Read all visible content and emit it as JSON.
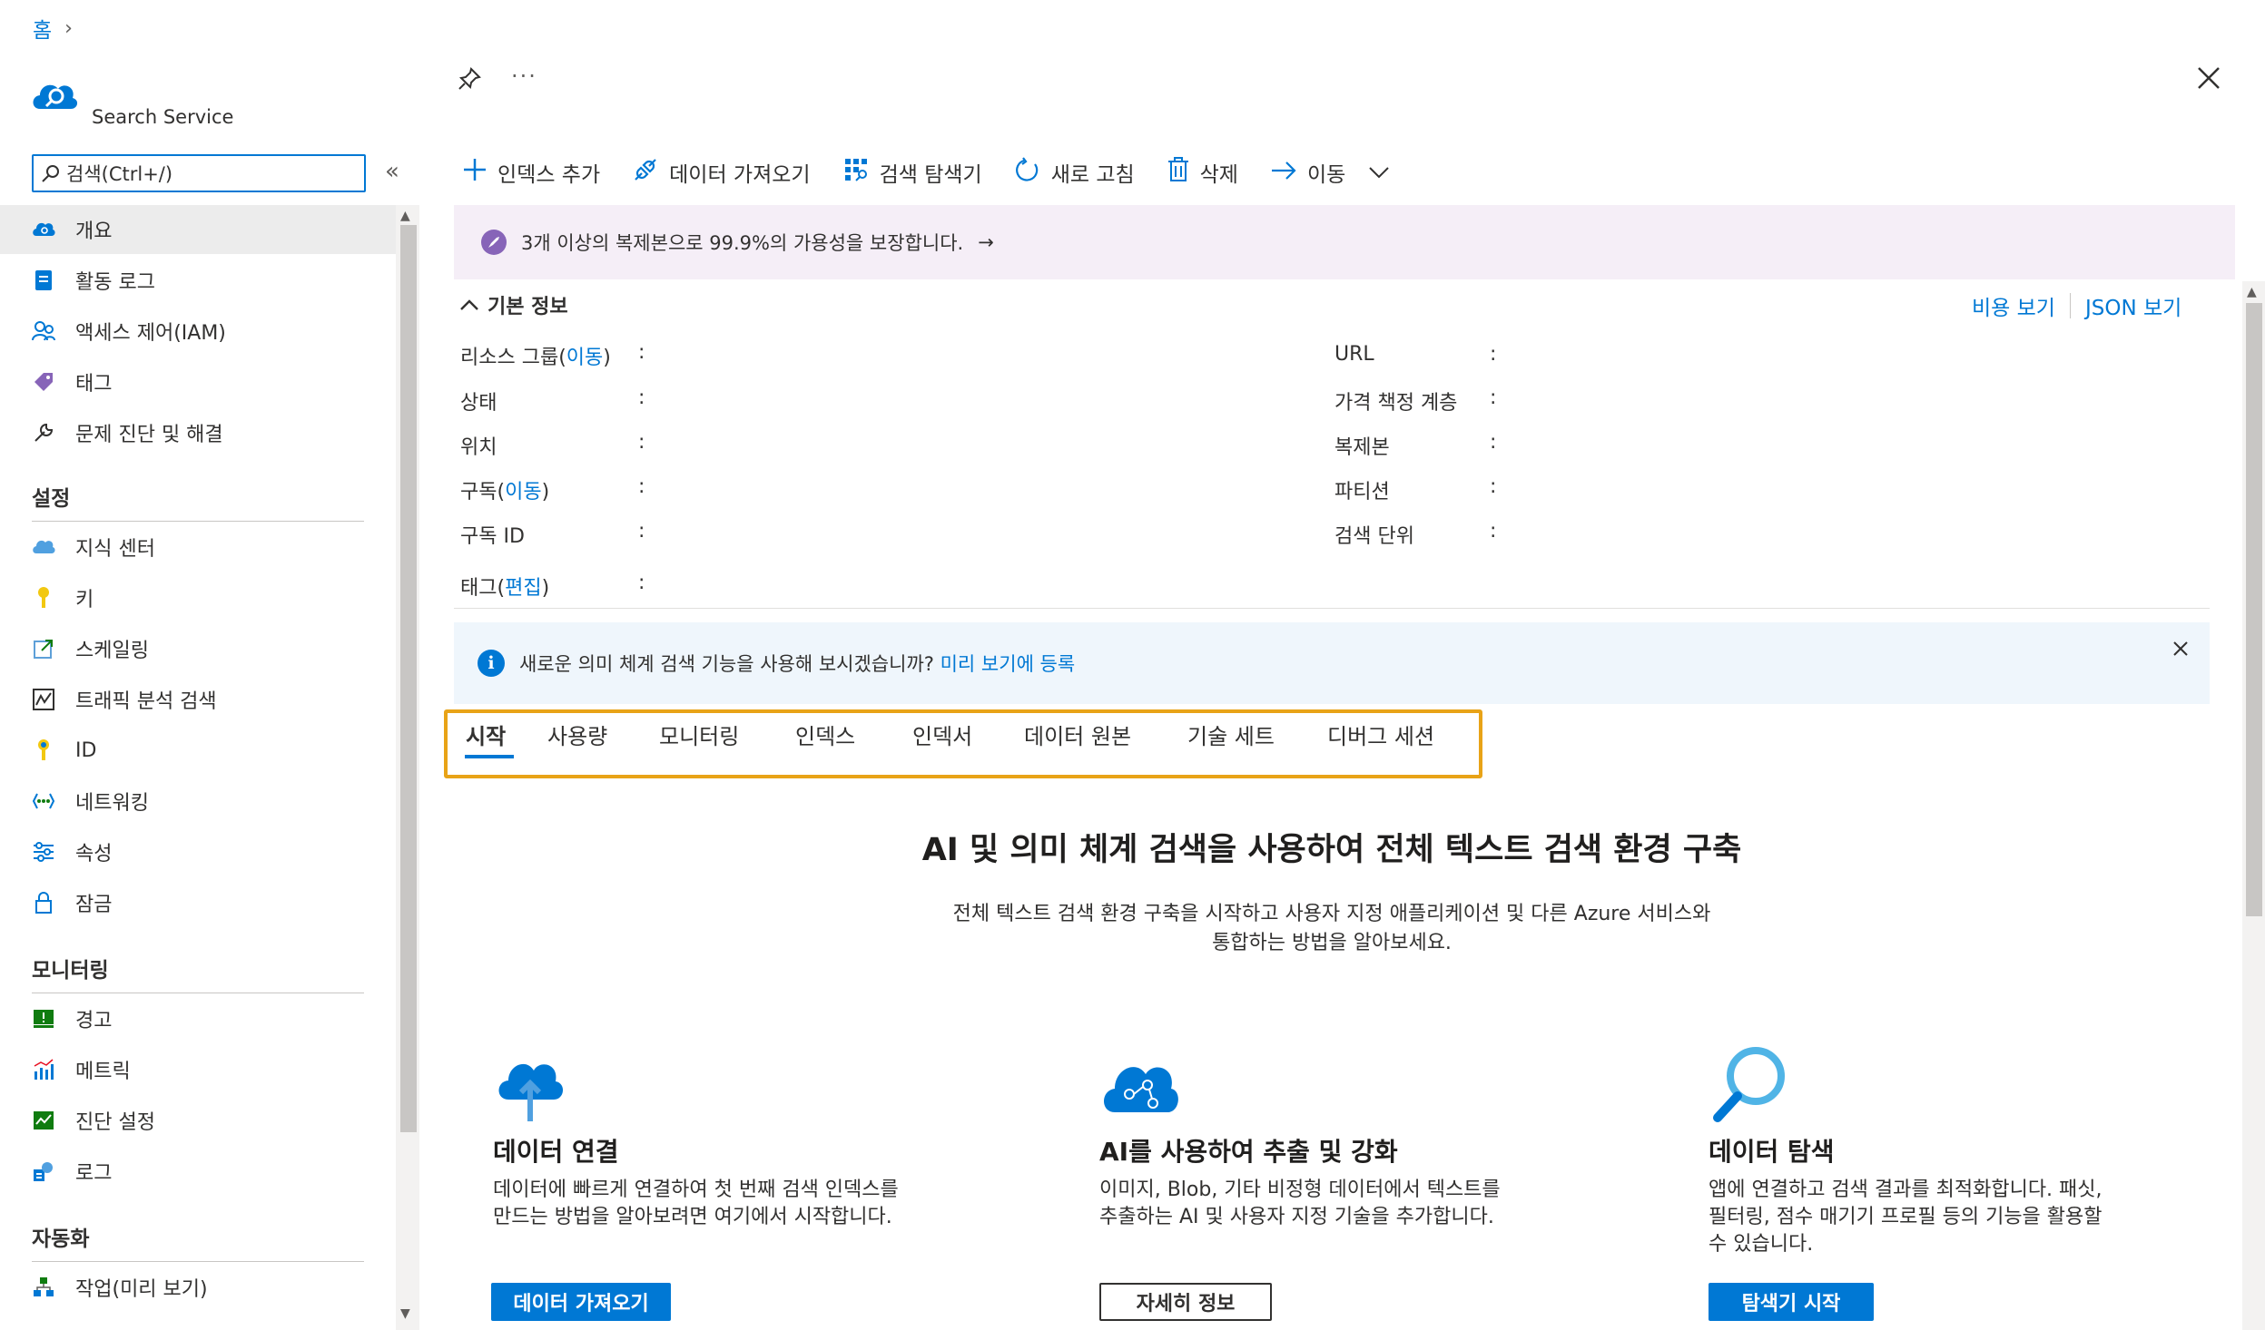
{
  "breadcrumb": {
    "home": "홈",
    "separator": "›"
  },
  "resource": {
    "type": "Search Service"
  },
  "sidebar": {
    "search_placeholder": "검색(Ctrl+/)",
    "collapse": "«",
    "top_items": [
      {
        "label": "개요",
        "icon": "overview-icon"
      },
      {
        "label": "활동 로그",
        "icon": "activity-log-icon"
      },
      {
        "label": "액세스 제어(IAM)",
        "icon": "iam-icon"
      },
      {
        "label": "태그",
        "icon": "tag-icon"
      },
      {
        "label": "문제 진단 및 해결",
        "icon": "wrench-icon"
      }
    ],
    "settings_header": "설정",
    "settings_items": [
      {
        "label": "지식 센터",
        "icon": "knowledge-center-icon"
      },
      {
        "label": "키",
        "icon": "key-icon"
      },
      {
        "label": "스케일링",
        "icon": "scale-icon"
      },
      {
        "label": "트래픽 분석 검색",
        "icon": "traffic-analytics-icon"
      },
      {
        "label": "ID",
        "icon": "identity-icon"
      },
      {
        "label": "네트워킹",
        "icon": "networking-icon"
      },
      {
        "label": "속성",
        "icon": "properties-icon"
      },
      {
        "label": "잠금",
        "icon": "lock-icon"
      }
    ],
    "monitoring_header": "모니터링",
    "monitoring_items": [
      {
        "label": "경고",
        "icon": "alert-icon"
      },
      {
        "label": "메트릭",
        "icon": "metrics-icon"
      },
      {
        "label": "진단 설정",
        "icon": "diagnostic-settings-icon"
      },
      {
        "label": "로그",
        "icon": "logs-icon"
      }
    ],
    "automation_header": "자동화",
    "automation_items": [
      {
        "label": "작업(미리 보기)",
        "icon": "tasks-icon"
      }
    ]
  },
  "toolbar": {
    "add_index": "인덱스 추가",
    "import_data": "데이터 가져오기",
    "search_explorer": "검색 탐색기",
    "refresh": "새로 고침",
    "delete": "삭제",
    "move": "이동"
  },
  "promo": {
    "text": "3개 이상의 복제본으로 99.9%의 가용성을 보장합니다.",
    "arrow": "→"
  },
  "essentials": {
    "toggle": "기본 정보",
    "view_cost": "비용 보기",
    "json_view": "JSON 보기",
    "left": {
      "resource_group": "리소스 그룹",
      "resource_group_link": "이동",
      "status": "상태",
      "location": "위치",
      "subscription": "구독",
      "subscription_link": "이동",
      "subscription_id": "구독 ID",
      "tags": "태그",
      "tags_link": "편집"
    },
    "right": {
      "url": "URL",
      "pricing_tier": "가격 책정 계층",
      "replicas": "복제본",
      "partitions": "파티션",
      "search_units": "검색 단위"
    },
    "colon": ":"
  },
  "info_banner": {
    "text": "새로운 의미 체계 검색 기능을 사용해 보시겠습니까?",
    "link": "미리 보기에 등록"
  },
  "tabs": [
    "시작",
    "사용량",
    "모니터링",
    "인덱스",
    "인덱서",
    "데이터 원본",
    "기술 세트",
    "디버그 세션"
  ],
  "hero": {
    "title": "AI 및 의미 체계 검색을 사용하여 전체 텍스트 검색 환경 구축",
    "desc_line1": "전체 텍스트 검색 환경 구축을 시작하고 사용자 지정 애플리케이션 및 다른 Azure 서비스와",
    "desc_line2": "통합하는 방법을 알아보세요."
  },
  "cards": [
    {
      "title": "데이터 연결",
      "desc1": "데이터에 빠르게 연결하여 첫 번째 검색 인덱스를",
      "desc2": "만드는 방법을 알아보려면 여기에서 시작합니다.",
      "desc3": "",
      "button": "데이터 가져오기"
    },
    {
      "title": "AI를 사용하여 추출 및 강화",
      "desc1": "이미지, Blob, 기타 비정형 데이터에서 텍스트를",
      "desc2": "추출하는 AI 및 사용자 지정 기술을 추가합니다.",
      "desc3": "",
      "button": "자세히 정보"
    },
    {
      "title": "데이터 탐색",
      "desc1": "앱에 연결하고 검색 결과를 최적화합니다. 패싯,",
      "desc2": "필터링, 점수 매기기 프로필 등의 기능을 활용할",
      "desc3": "수 있습니다.",
      "button": "탐색기 시작"
    }
  ],
  "colors": {
    "accent": "#0078d4",
    "highlight": "#e8a317",
    "promo_bg": "#f5eef7",
    "info_bg": "#eff6fc"
  }
}
